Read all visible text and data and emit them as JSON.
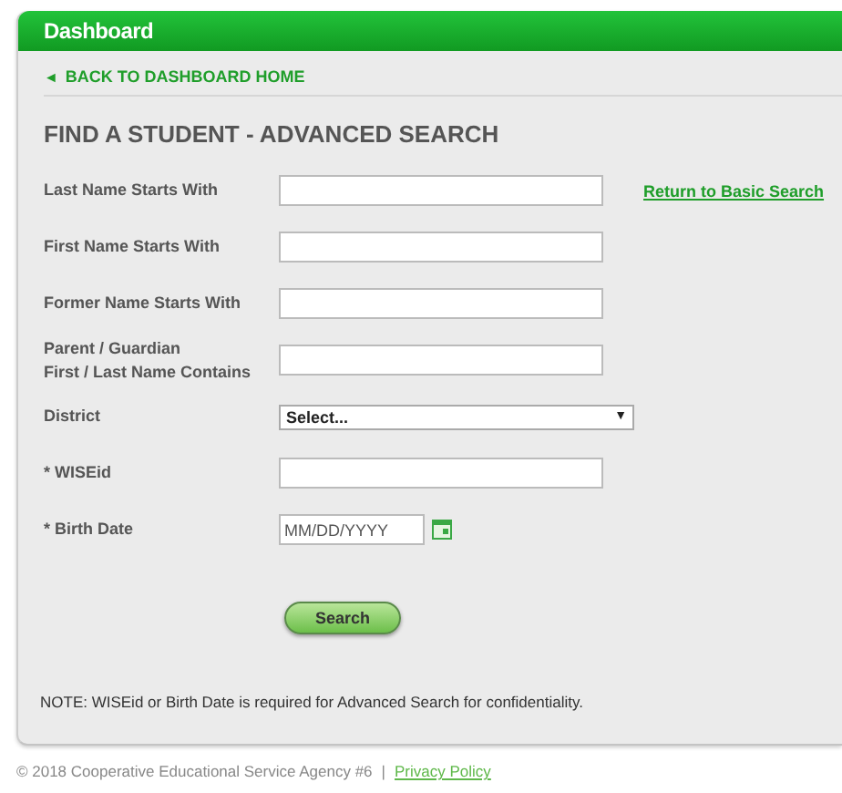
{
  "header": {
    "title": "Dashboard"
  },
  "back_link": {
    "arrow": "◄",
    "label": "BACK TO DASHBOARD HOME"
  },
  "page_title": "FIND A STUDENT - ADVANCED SEARCH",
  "basic_search_link": "Return to Basic Search",
  "fields": [
    {
      "kind": "text",
      "label_lines": [
        "Last Name Starts With"
      ]
    },
    {
      "kind": "text",
      "label_lines": [
        "First Name Starts With"
      ]
    },
    {
      "kind": "text",
      "label_lines": [
        "Former Name Starts With"
      ]
    },
    {
      "kind": "text",
      "label_lines": [
        "Parent / Guardian",
        "First / Last Name Contains"
      ]
    },
    {
      "kind": "select",
      "label_lines": [
        "District"
      ],
      "value": "Select...",
      "arrow": "▼"
    },
    {
      "kind": "text",
      "label_lines": [
        "* WISEid"
      ]
    },
    {
      "kind": "date",
      "label_lines": [
        "* Birth Date"
      ],
      "placeholder": "MM/DD/YYYY"
    }
  ],
  "search_button": "Search",
  "note": "NOTE: WISEid or Birth Date is required for Advanced Search for confidentiality.",
  "footer": {
    "copyright": "© 2018 Cooperative Educational Service Agency #6",
    "separator": "|",
    "link": "Privacy Policy"
  }
}
